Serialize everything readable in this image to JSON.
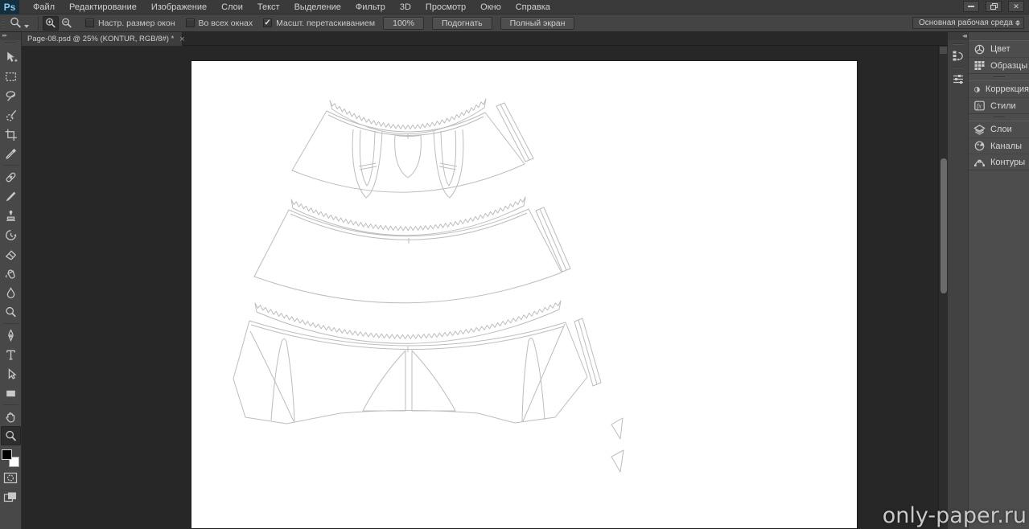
{
  "menu": {
    "logo": "Ps",
    "items": [
      "Файл",
      "Редактирование",
      "Изображение",
      "Слои",
      "Текст",
      "Выделение",
      "Фильтр",
      "3D",
      "Просмотр",
      "Окно",
      "Справка"
    ]
  },
  "window_controls": {
    "close": "✕"
  },
  "options": {
    "checkboxes": [
      {
        "label": "Настр. размер окон",
        "checked": false,
        "mark": ""
      },
      {
        "label": "Во всех окнах",
        "checked": false,
        "mark": ""
      },
      {
        "label": "Масшт. перетаскиванием",
        "checked": true,
        "mark": "✓"
      }
    ],
    "buttons": [
      "100%",
      "Подогнать",
      "Полный экран"
    ],
    "workspace": "Основная рабочая среда"
  },
  "tab": {
    "title": "Page-08.psd @ 25% (KONTUR, RGB/8#) *",
    "close": "×"
  },
  "toolbar": {
    "tools": [
      "move",
      "rectangular-marquee",
      "lasso",
      "quick-selection",
      "crop",
      "eyedropper",
      "spot-healing-brush",
      "brush",
      "clone-stamp",
      "history-brush",
      "eraser",
      "paint-bucket",
      "blur",
      "dodge",
      "pen",
      "type",
      "path-selection",
      "rectangle-shape",
      "hand",
      "zoom"
    ],
    "selected": "zoom"
  },
  "dock": {
    "strip_icons": [
      "history",
      "properties"
    ],
    "groups": [
      [
        {
          "label": "Цвет"
        },
        {
          "label": "Образцы"
        }
      ],
      [
        {
          "label": "Коррекция"
        },
        {
          "label": "Стили"
        }
      ],
      [
        {
          "label": "Слои"
        },
        {
          "label": "Каналы"
        },
        {
          "label": "Контуры"
        }
      ]
    ],
    "styles_glyph": "fx"
  },
  "watermark": "only-paper.ru",
  "colors": {
    "logo_blue": "#8ecbf0",
    "outline": "#bdbdbd",
    "page": "#ffffff",
    "pasteboard": "#272727"
  }
}
